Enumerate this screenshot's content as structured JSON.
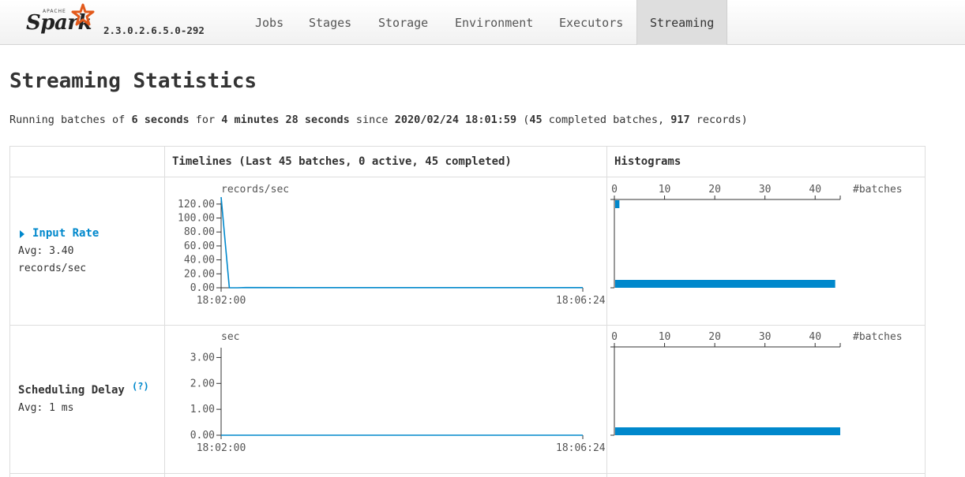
{
  "app": {
    "brand_small": "APACHE",
    "brand": "Spark",
    "version": "2.3.0.2.6.5.0-292",
    "accent": "#0088cc",
    "nav_tabs": [
      {
        "label": "Jobs",
        "active": false
      },
      {
        "label": "Stages",
        "active": false
      },
      {
        "label": "Storage",
        "active": false
      },
      {
        "label": "Environment",
        "active": false
      },
      {
        "label": "Executors",
        "active": false
      },
      {
        "label": "Streaming",
        "active": true
      }
    ]
  },
  "page": {
    "title": "Streaming Statistics",
    "summary": {
      "t1": "Running batches of ",
      "batch_interval": "6 seconds",
      "t2": " for ",
      "duration": "4 minutes 28 seconds",
      "t3": " since ",
      "start_time": "2020/02/24 18:01:59",
      "t4": " (",
      "completed_batches": "45",
      "t5": " completed batches, ",
      "records": "917",
      "t6": " records)"
    }
  },
  "table": {
    "header_timelines": "Timelines (Last 45 batches, 0 active, 45 completed)",
    "header_histograms": "Histograms",
    "rows": [
      {
        "name": "Input Rate",
        "avg": "Avg: 3.40",
        "unit": "records/sec",
        "caret_icon": "triangle-right-icon"
      },
      {
        "name": "Scheduling Delay",
        "help": "(?)",
        "avg": "Avg: 1 ms"
      }
    ]
  },
  "chart_data": [
    {
      "type": "line",
      "ylabel": "records/sec",
      "y_ticks": [
        "0.00",
        "20.00",
        "40.00",
        "60.00",
        "80.00",
        "100.00",
        "120.00"
      ],
      "x_ticks": [
        "18:02:00",
        "18:06:24"
      ],
      "ylim": [
        0,
        130
      ],
      "x": [
        0,
        1,
        2,
        3,
        10,
        20,
        30,
        44
      ],
      "values": [
        130,
        0,
        0,
        0.3,
        0.2,
        0.2,
        0.2,
        0.2
      ],
      "color": "#0088cc"
    },
    {
      "type": "bar",
      "orientation": "horizontal",
      "xlabel": "#batches",
      "x_ticks": [
        "0",
        "10",
        "20",
        "30",
        "40"
      ],
      "xlim": [
        0,
        45
      ],
      "ylim": [
        0,
        130
      ],
      "bins": [
        {
          "value": 0,
          "count": 44
        },
        {
          "value": 130,
          "count": 1
        }
      ],
      "color": "#0088cc"
    },
    {
      "type": "line",
      "ylabel": "sec",
      "y_ticks": [
        "0.00",
        "1.00",
        "2.00",
        "3.00"
      ],
      "x_ticks": [
        "18:02:00",
        "18:06:24"
      ],
      "ylim": [
        0,
        3.5
      ],
      "x": [
        0,
        44
      ],
      "values": [
        0.001,
        0.001
      ],
      "color": "#0088cc"
    },
    {
      "type": "bar",
      "orientation": "horizontal",
      "xlabel": "#batches",
      "x_ticks": [
        "0",
        "10",
        "20",
        "30",
        "40"
      ],
      "xlim": [
        0,
        45
      ],
      "ylim": [
        0,
        3.5
      ],
      "bins": [
        {
          "value": 0,
          "count": 45
        }
      ],
      "color": "#0088cc"
    }
  ]
}
